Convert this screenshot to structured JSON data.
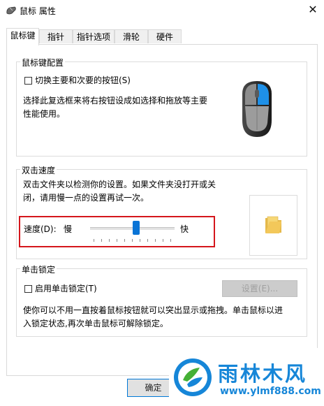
{
  "window": {
    "title": "鼠标 属性",
    "close_glyph": "✕"
  },
  "tabs": [
    {
      "label": "鼠标键",
      "active": true
    },
    {
      "label": "指针",
      "active": false
    },
    {
      "label": "指针选项",
      "active": false
    },
    {
      "label": "滑轮",
      "active": false
    },
    {
      "label": "硬件",
      "active": false
    }
  ],
  "button_config": {
    "group_title": "鼠标键配置",
    "switch_checkbox_label": "切换主要和次要的按钮(S)",
    "switch_checked": false,
    "description_line1": "选择此复选框来将右按钮设成如选择和拖放等主要",
    "description_line2": "性能使用。"
  },
  "double_click": {
    "group_title": "双击速度",
    "description_line1": "双击文件夹以检测你的设置。如果文件夹没打开或关",
    "description_line2": "闭，请用慢一点的设置再试一次。",
    "speed_label": "速度(D):",
    "slow_label": "慢",
    "fast_label": "快",
    "speed_level_fraction": 0.55,
    "tick_count": 11
  },
  "click_lock": {
    "group_title": "单击锁定",
    "checkbox_label": "启用单击锁定(T)",
    "checked": false,
    "settings_button": "设置(E)...",
    "settings_enabled": false,
    "description_line1": "使你可以不用一直按着鼠标按钮就可以突出显示或拖拽。单击鼠标以进",
    "description_line2": "入锁定状态,再次单击鼠标可解除锁定。"
  },
  "footer": {
    "ok_button": "确定"
  },
  "watermark": {
    "title": "雨林木风",
    "url": "www.ylmf888.com"
  },
  "colors": {
    "accent": "#0a74d6",
    "highlight_border": "#d5161c",
    "watermark": "#1686d8",
    "mouse_body": "#3b3b3b",
    "mouse_button": "#1e90e8"
  }
}
